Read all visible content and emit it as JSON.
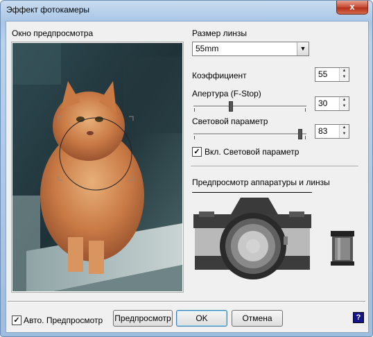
{
  "window": {
    "title": "Эффект фотокамеры",
    "close_glyph": "x"
  },
  "preview": {
    "label": "Окно предпросмотра"
  },
  "lens": {
    "label": "Размер линзы",
    "value": "55mm"
  },
  "coefficient": {
    "label": "Коэффициент",
    "value": "55"
  },
  "aperture": {
    "label": "Апертура (F-Stop)",
    "value": "30",
    "level": 0.33
  },
  "light": {
    "label": "Световой параметр",
    "value": "83",
    "level": 0.95
  },
  "light_toggle": {
    "label": "Вкл. Световой параметр",
    "checked": true
  },
  "hardware": {
    "label": "Предпросмотр аппаратуры и линзы"
  },
  "footer": {
    "auto_preview_label": "Авто. Предпросмотр",
    "auto_preview_checked": true,
    "preview_button": "Предпросмотр",
    "ok_button": "OK",
    "cancel_button": "Отмена",
    "help_glyph": "?"
  },
  "colors": {
    "title_bg": "#b8d1ec",
    "client_bg": "#f0f0f0",
    "close_red": "#c9533b",
    "help_blue": "#14148a"
  }
}
